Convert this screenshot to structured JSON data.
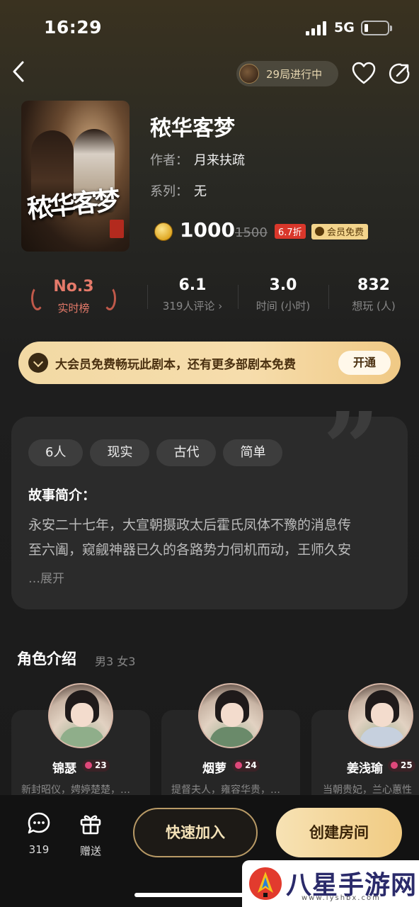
{
  "status_bar": {
    "time": "16:29",
    "network": "5G"
  },
  "header": {
    "in_progress_label": "29局进行中"
  },
  "script": {
    "cover_title": "秾华客梦",
    "title": "秾华客梦",
    "author_label": "作者：",
    "author": "月来扶疏",
    "series_label": "系列：",
    "series": "无",
    "price": "1000",
    "original_price": "1500",
    "discount": "6.7折",
    "vip_free": "会员免费"
  },
  "stats": {
    "rank": "No.3",
    "rank_label": "实时榜",
    "score": "6.1",
    "reviews_label": "319人评论 ›",
    "duration": "3.0",
    "duration_label": "时间 (小时)",
    "want": "832",
    "want_label": "想玩 (人)"
  },
  "vip_banner": {
    "text": "大会员免费畅玩此剧本，还有更多部剧本免费",
    "button": "开通"
  },
  "story": {
    "tags": [
      "6人",
      "现实",
      "古代",
      "简单"
    ],
    "heading": "故事简介：",
    "line1": "永安二十七年，大宣朝摄政太后霍氏凤体不豫的消息传",
    "line2": "至六阖，窥觎神器已久的各路势力伺机而动，王师久安",
    "expand": "…展开"
  },
  "roles": {
    "heading": "角色介绍",
    "summary": "男3 女3",
    "items": [
      {
        "name": "锦瑟",
        "count": "23",
        "desc": "新封昭仪，娉婷楚楚，…"
      },
      {
        "name": "烟萝",
        "count": "24",
        "desc": "提督夫人，雍容华贵，…"
      },
      {
        "name": "姜浅瑜",
        "count": "25",
        "desc": "当朝贵妃，兰心蕙性"
      }
    ]
  },
  "bottom_bar": {
    "chat_count": "319",
    "gift_label": "赠送",
    "join_button": "快速加入",
    "create_button": "创建房间"
  },
  "watermark": {
    "title": "八星手游网",
    "url": "www.lyshbx.com"
  },
  "colors": {
    "accent_gold": "#f1cb82",
    "rank_red": "#e57a6a",
    "discount_red": "#d9372b"
  }
}
